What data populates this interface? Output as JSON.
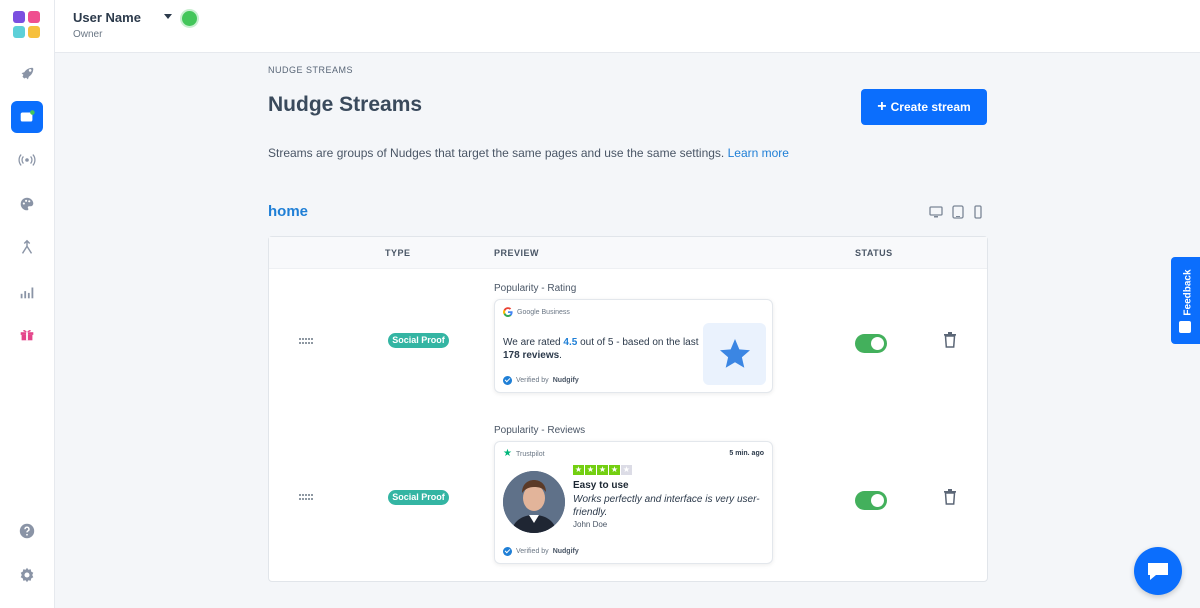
{
  "topbar": {
    "user_name": "User Name",
    "user_role": "Owner"
  },
  "sidebar": {
    "items": [
      {
        "name": "launch",
        "icon": "rocket-icon"
      },
      {
        "name": "nudges",
        "icon": "nudge-icon",
        "active": true
      },
      {
        "name": "broadcast",
        "icon": "broadcast-icon"
      },
      {
        "name": "design",
        "icon": "palette-icon"
      },
      {
        "name": "integrations",
        "icon": "merge-icon"
      },
      {
        "name": "analytics",
        "icon": "chart-icon"
      },
      {
        "name": "rewards",
        "icon": "gift-icon"
      }
    ],
    "bottom": [
      {
        "name": "help",
        "icon": "help-icon"
      },
      {
        "name": "settings",
        "icon": "gear-icon"
      }
    ]
  },
  "page": {
    "breadcrumb": "NUDGE STREAMS",
    "title": "Nudge Streams",
    "create_label": "Create stream",
    "description": "Streams are groups of Nudges that target the same pages and use the same settings.",
    "learn_more": "Learn more"
  },
  "stream": {
    "name": "home",
    "devices": [
      "desktop-icon",
      "tablet-icon",
      "mobile-icon"
    ],
    "columns": {
      "type": "TYPE",
      "preview": "PREVIEW",
      "status": "STATUS"
    },
    "rows": [
      {
        "type": "Social Proof",
        "preview_title": "Popularity - Rating",
        "source": "Google Business",
        "text_a": "We are rated ",
        "rating": "4.5",
        "text_b": " out of 5 - based on the last ",
        "reviews": "178 reviews",
        "text_c": ".",
        "verified_prefix": "Verified by",
        "verified_brand": "Nudgify",
        "enabled": true
      },
      {
        "type": "Social Proof",
        "preview_title": "Popularity - Reviews",
        "source": "Trustpilot",
        "time": "5 min. ago",
        "stars": 4,
        "review_title": "Easy to use",
        "review_body": "Works perfectly and interface is very user-friendly.",
        "author": "John Doe",
        "verified_prefix": "Verified by",
        "verified_brand": "Nudgify",
        "enabled": true
      }
    ]
  },
  "widgets": {
    "feedback_label": "Feedback"
  },
  "colors": {
    "primary": "#0b6efd",
    "link": "#1f7fd6",
    "badge": "#34b5a3",
    "toggle_on": "#43b05c",
    "online": "#43c65a",
    "trustpilot": "#00b67a",
    "tp_star": "#73cf11"
  }
}
